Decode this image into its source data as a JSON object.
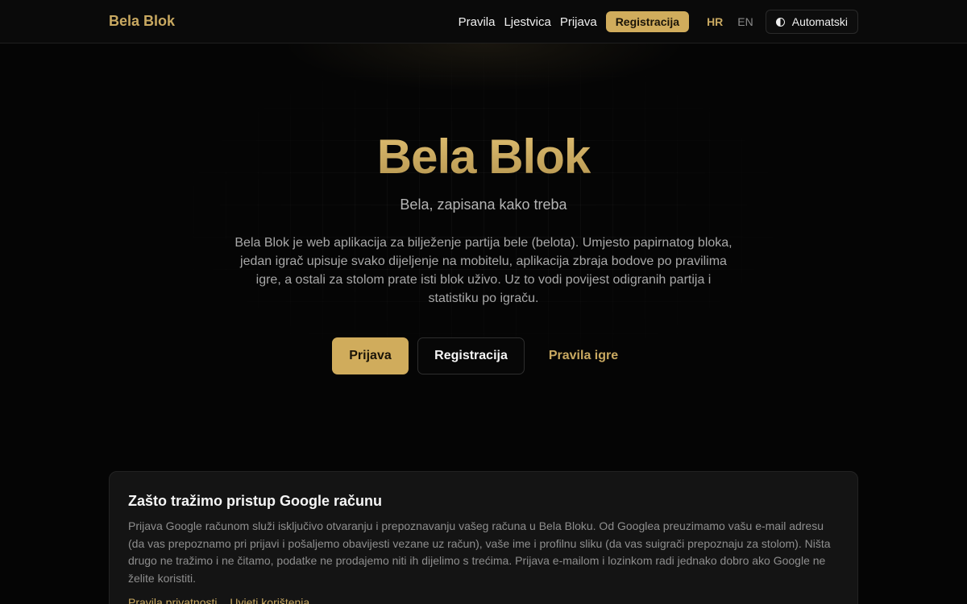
{
  "header": {
    "logo": "Bela Blok",
    "nav": {
      "rules": "Pravila",
      "leaderboard": "Ljestvica",
      "login": "Prijava",
      "register": "Registracija"
    },
    "languages": {
      "hr": "HR",
      "en": "EN",
      "active": "HR"
    },
    "theme": {
      "label": "Automatski",
      "icon": "half-circle-icon"
    }
  },
  "hero": {
    "title": "Bela Blok",
    "subtitle": "Bela, zapisana kako treba",
    "description": "Bela Blok je web aplikacija za bilježenje partija bele (belota). Umjesto papirnatog bloka, jedan igrač upisuje svako dijeljenje na mobitelu, aplikacija zbraja bodove po pravilima igre, a ostali za stolom prate isti blok uživo. Uz to vodi povijest odigranih partija i statistiku po igraču.",
    "buttons": {
      "login": "Prijava",
      "register": "Registracija",
      "rules": "Pravila igre"
    }
  },
  "google_card": {
    "title": "Zašto tražimo pristup Google računu",
    "text": "Prijava Google računom služi isključivo otvaranju i prepoznavanju vašeg računa u Bela Bloku. Od Googlea preuzimamo vašu e-mail adresu (da vas prepoznamo pri prijavi i pošaljemo obavijesti vezane uz račun), vaše ime i profilnu sliku (da vas suigrači prepoznaju za stolom). Ništa drugo ne tražimo i ne čitamo, podatke ne prodajemo niti ih dijelimo s trećima. Prijava e-mailom i lozinkom radi jednako dobro ako Google ne želite koristiti.",
    "links": {
      "privacy": "Pravila privatnosti",
      "terms": "Uvjeti korištenja"
    }
  },
  "colors": {
    "accent": "#c9a961",
    "button_gold": "#d0ac5c",
    "background": "#050505",
    "card_bg": "#141414"
  }
}
